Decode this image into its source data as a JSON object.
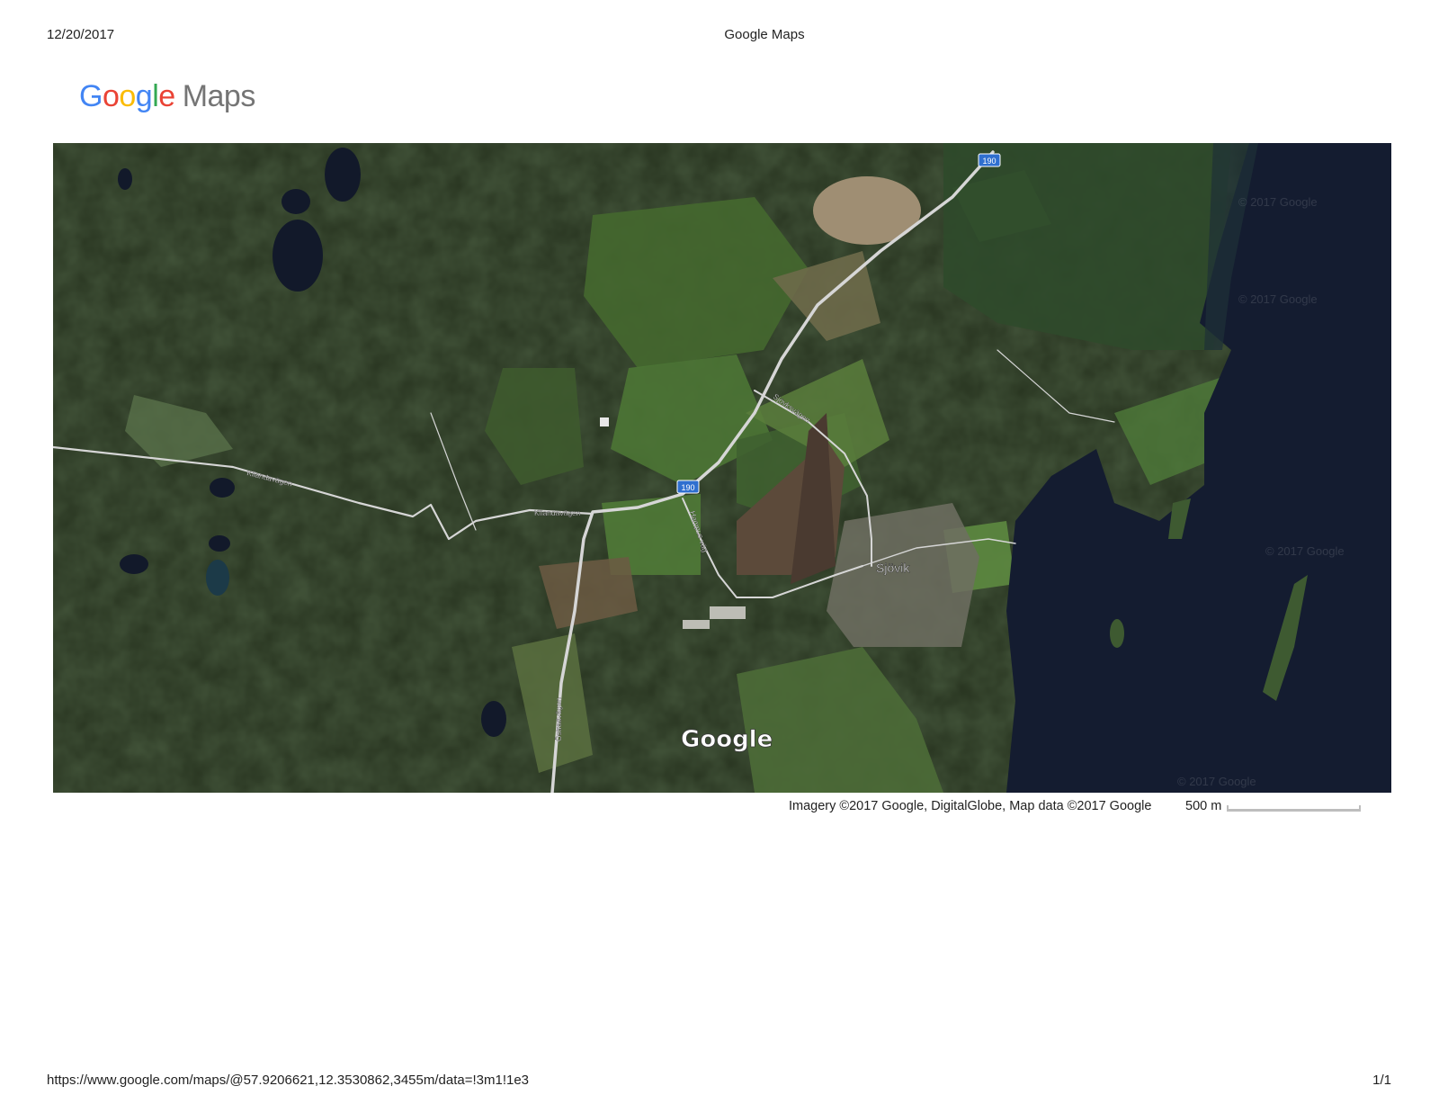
{
  "print_header": {
    "date": "12/20/2017",
    "title": "Google Maps"
  },
  "logo": {
    "letters": [
      "G",
      "o",
      "o",
      "g",
      "l",
      "e"
    ],
    "suffix": "Maps"
  },
  "map": {
    "road_labels": {
      "route_190_north": "190",
      "route_190_mid": "190",
      "kilandavagen_west": "Kilandavägen",
      "kilandavagen_east": "Kilandavägen",
      "sjovksvagen": "Sjövksvägen",
      "hampus_vag": "Hampus väg",
      "ostradvagen": "Östradvägen"
    },
    "place_label": "Sjövik",
    "watermark": "Google",
    "tile_watermarks": [
      "© 2017 Google",
      "© 2017 Google",
      "© 2017 Google",
      "© 2017 Google"
    ]
  },
  "attribution": "Imagery ©2017 Google, DigitalGlobe, Map data ©2017 Google",
  "scale": {
    "label": "500 m"
  },
  "print_footer": {
    "url": "https://www.google.com/maps/@57.9206621,12.3530862,3455m/data=!3m1!1e3",
    "page": "1/1"
  },
  "colors": {
    "google_blue": "#4285F4",
    "google_red": "#EA4335",
    "google_yellow": "#FBBC05",
    "google_green": "#34A853",
    "forest": "#24301c",
    "field": "#4f7a3a",
    "water": "#141c30",
    "road": "#d9d9d9",
    "shield": "#2f6fcf"
  }
}
